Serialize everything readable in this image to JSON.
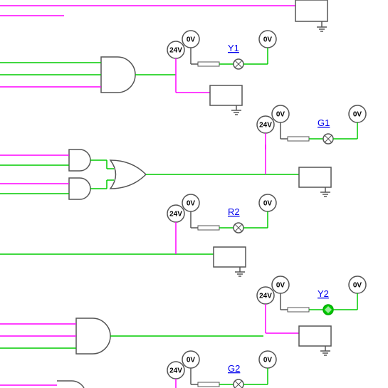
{
  "voltages": {
    "v24": "24V",
    "v0": "0V"
  },
  "labels": {
    "y1": "Y1",
    "g1": "G1",
    "r2": "R2",
    "y2": "Y2",
    "g2": "G2"
  },
  "colors": {
    "wire_magenta": "#FF00FF",
    "wire_green": "#00CC00",
    "component": "#555555",
    "indicator_green": "#00CC00"
  }
}
